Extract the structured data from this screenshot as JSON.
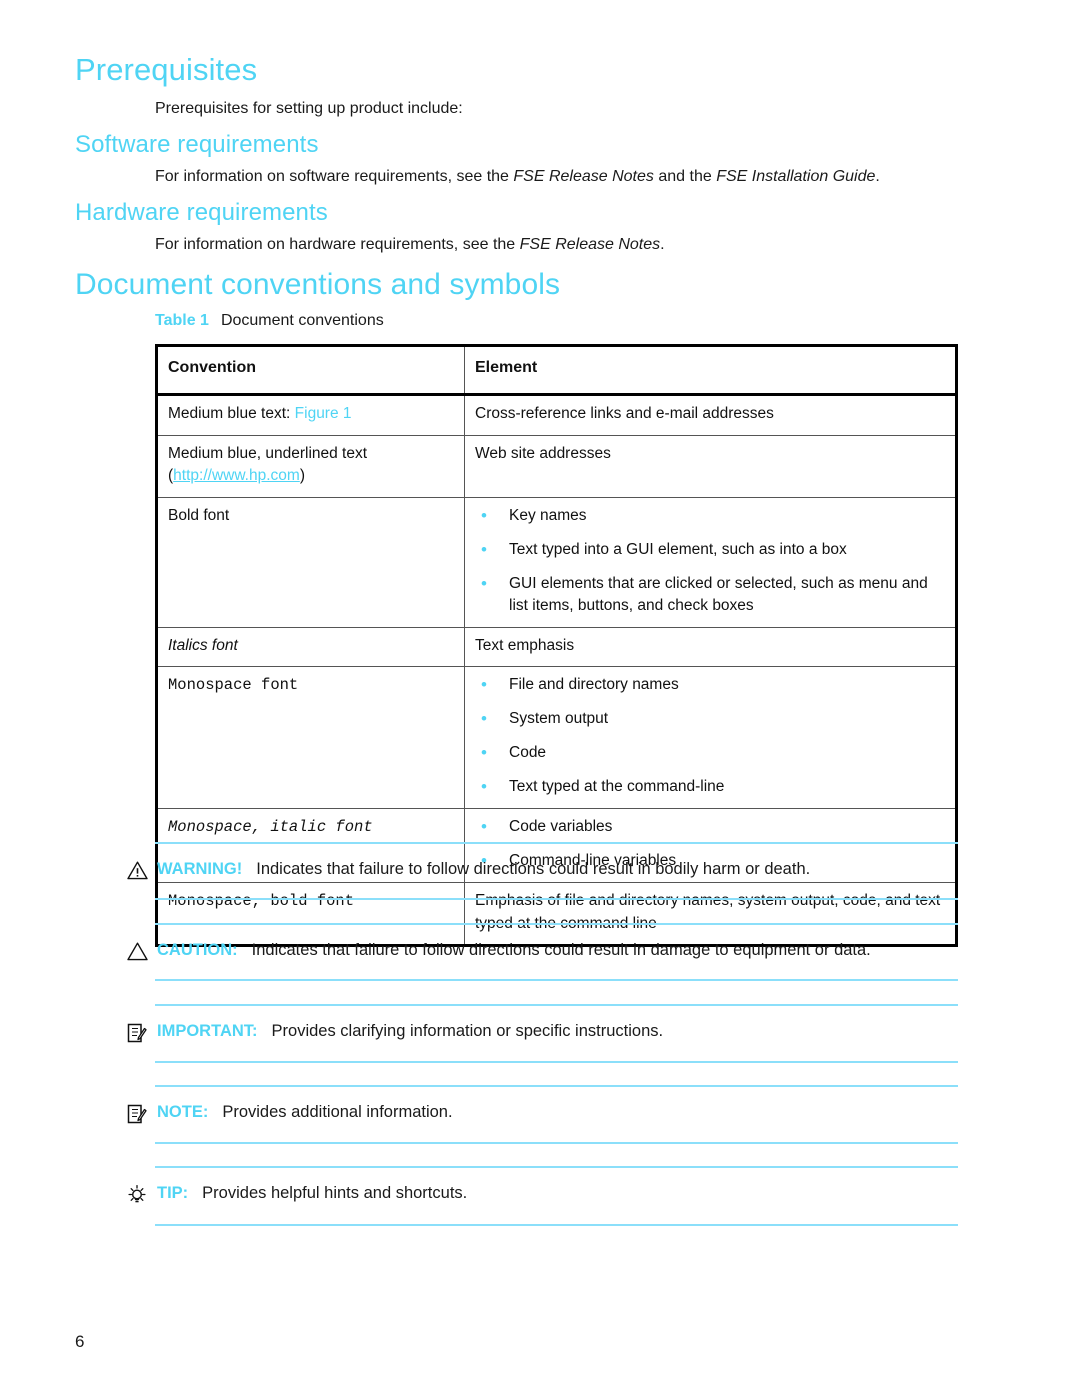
{
  "colors": {
    "accent": "#4FD4F4",
    "rule": "#8BDFFA",
    "text": "#1a1a1a",
    "table_border": "#000000"
  },
  "sections": {
    "prerequisites": {
      "heading": "Prerequisites",
      "intro": "Prerequisites for setting up product include:",
      "software": {
        "heading": "Software requirements",
        "text_before": "For information on software requirements, see the ",
        "italic_1": "FSE Release Notes",
        "text_middle": " and the ",
        "italic_2": "FSE Installation Guide",
        "text_after": "."
      },
      "hardware": {
        "heading": "Hardware requirements",
        "text_before": "For information on hardware requirements, see the ",
        "italic_1": "FSE Release Notes",
        "text_after": "."
      }
    },
    "conventions": {
      "heading": "Document conventions and symbols"
    }
  },
  "table": {
    "caption_label": "Table 1",
    "caption_text": "Document conventions",
    "headers": [
      "Convention",
      "Element"
    ],
    "rows": [
      {
        "convention_prefix": "Medium blue text: ",
        "convention_link": "Figure 1",
        "element": "Cross-reference links and e-mail addresses"
      },
      {
        "convention_line1": "Medium blue, underlined text",
        "convention_open_paren": "(",
        "convention_url": "http://www.hp.com",
        "convention_close_paren": ")",
        "element": "Web site addresses"
      },
      {
        "convention": "Bold font",
        "bullets": [
          "Key names",
          "Text typed into a GUI element, such as into a box",
          "GUI elements that are clicked or selected, such as menu and list items, buttons, and check boxes"
        ]
      },
      {
        "convention": "Italics font",
        "element": "Text emphasis"
      },
      {
        "convention": "Monospace font",
        "bullets": [
          "File and directory names",
          "System output",
          "Code",
          "Text typed at the command-line"
        ]
      },
      {
        "convention": "Monospace, italic font",
        "bullets": [
          "Code variables",
          "Command-line variables"
        ]
      },
      {
        "convention": "Monospace, bold font",
        "element": "Emphasis of file and directory names, system output, code, and text typed at the command line"
      }
    ]
  },
  "admonitions": [
    {
      "icon": "warning-triangle-icon",
      "label": "WARNING!",
      "text": "Indicates that failure to follow directions could result in bodily harm or death."
    },
    {
      "icon": "caution-triangle-icon",
      "label": "CAUTION:",
      "text": "Indicates that failure to follow directions could result in damage to equipment or data."
    },
    {
      "icon": "important-notepad-icon",
      "label": "IMPORTANT:",
      "text": "Provides clarifying information or specific instructions."
    },
    {
      "icon": "note-notepad-icon",
      "label": "NOTE:",
      "text": "Provides additional information."
    },
    {
      "icon": "tip-lightbulb-icon",
      "label": "TIP:",
      "text": "Provides helpful hints and shortcuts."
    }
  ],
  "footer": {
    "page_number": "6"
  }
}
